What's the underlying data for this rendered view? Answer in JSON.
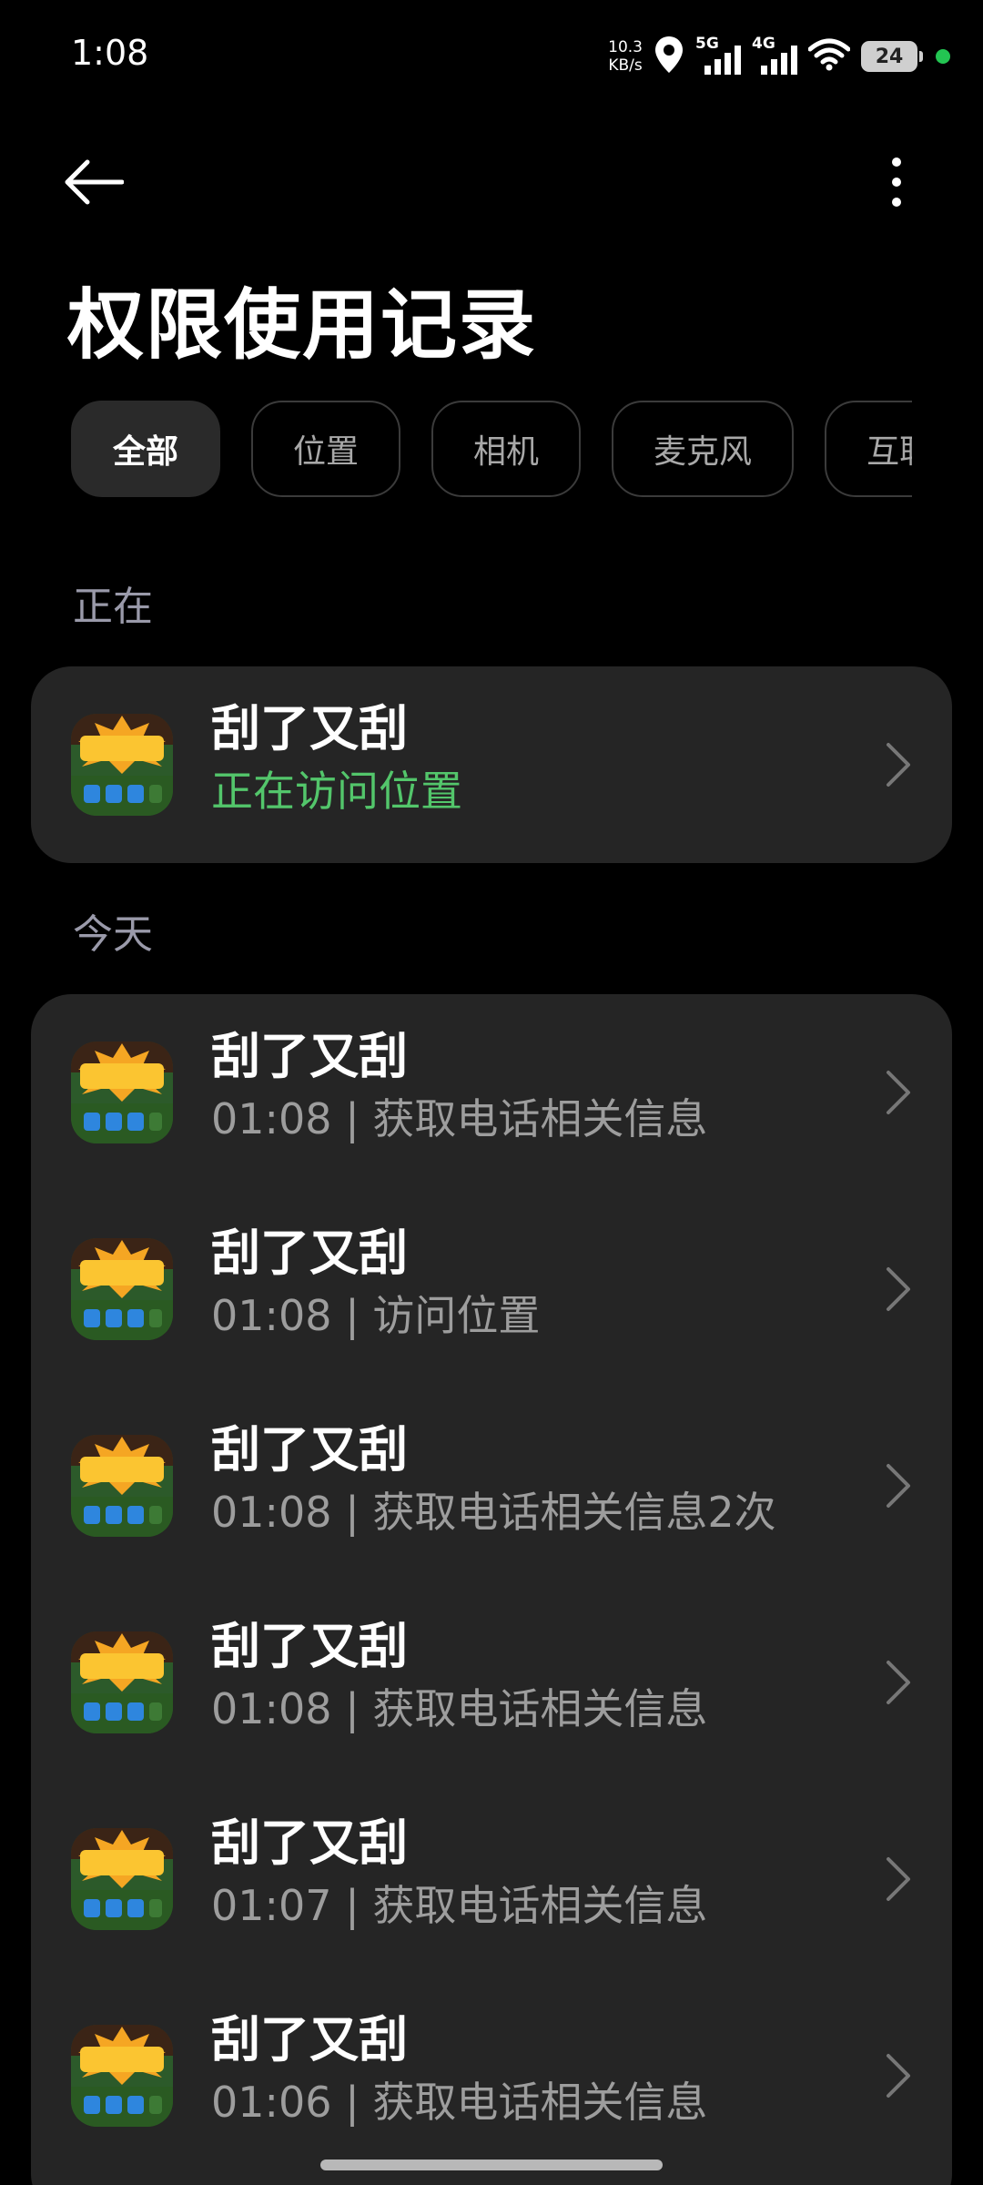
{
  "status_bar": {
    "time": "1:08",
    "net_speed_value": "10.3",
    "net_speed_unit": "KB/s",
    "signal1_label": "5G",
    "signal2_label": "4G",
    "battery_level": "24",
    "icons": [
      "location-icon",
      "signal-icon",
      "wifi-icon",
      "battery-icon"
    ]
  },
  "header": {
    "title": "权限使用记录",
    "back_icon": "back-arrow-icon",
    "more_icon": "more-vertical-icon"
  },
  "filters": [
    {
      "label": "全部",
      "active": true
    },
    {
      "label": "位置",
      "active": false
    },
    {
      "label": "相机",
      "active": false
    },
    {
      "label": "麦克风",
      "active": false
    },
    {
      "label": "互联",
      "active": false
    }
  ],
  "sections": {
    "current": {
      "header": "正在",
      "items": [
        {
          "app": "刮了又刮",
          "status": "正在访问位置"
        }
      ]
    },
    "today": {
      "header": "今天",
      "items": [
        {
          "app": "刮了又刮",
          "time": "01:08",
          "separator": "|",
          "action": "获取电话相关信息"
        },
        {
          "app": "刮了又刮",
          "time": "01:08",
          "separator": "|",
          "action": "访问位置"
        },
        {
          "app": "刮了又刮",
          "time": "01:08",
          "separator": "|",
          "action": "获取电话相关信息2次"
        },
        {
          "app": "刮了又刮",
          "time": "01:08",
          "separator": "|",
          "action": "获取电话相关信息"
        },
        {
          "app": "刮了又刮",
          "time": "01:07",
          "separator": "|",
          "action": "获取电话相关信息"
        },
        {
          "app": "刮了又刮",
          "time": "01:06",
          "separator": "|",
          "action": "获取电话相关信息"
        }
      ]
    }
  },
  "app_icon_text": "刮了又刮",
  "colors": {
    "background": "#000000",
    "card": "#252525",
    "active_status": "#53c66b",
    "secondary_text": "#9d9d9d",
    "section_header": "#9a9aaa"
  }
}
